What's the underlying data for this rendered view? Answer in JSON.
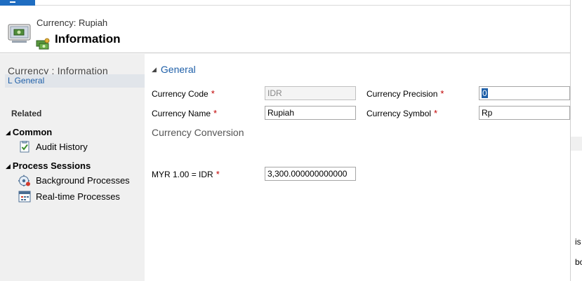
{
  "header": {
    "subtitle": "Currency: Rupiah",
    "title": "Information"
  },
  "sidebar": {
    "title": "Currency : Information",
    "general_link": "L  General",
    "related_label": "Related",
    "groups": [
      {
        "label": "Common",
        "items": [
          {
            "label": "Audit History",
            "icon": "audit-history-icon"
          }
        ]
      },
      {
        "label": "Process Sessions",
        "items": [
          {
            "label": "Background Processes",
            "icon": "background-processes-icon"
          },
          {
            "label": "Real-time Processes",
            "icon": "realtime-processes-icon"
          }
        ]
      }
    ]
  },
  "form": {
    "section_title": "General",
    "currency_code": {
      "label": "Currency Code",
      "required": "*",
      "value": "IDR"
    },
    "currency_precision": {
      "label": "Currency Precision",
      "required": "*",
      "value": "0"
    },
    "currency_name": {
      "label": "Currency Name",
      "required": "*",
      "value": "Rupiah"
    },
    "currency_symbol": {
      "label": "Currency Symbol",
      "required": "*",
      "value": "Rp"
    },
    "conversion_title": "Currency Conversion",
    "exchange_rate": {
      "label": "MYR 1.00 = IDR",
      "required": "*",
      "value": "3,300.000000000000"
    }
  },
  "colors": {
    "accent": "#1e5fa8",
    "required": "#c00000",
    "sidebar_bg": "#f0f0f0",
    "top_tab": "#1f6dc1"
  }
}
